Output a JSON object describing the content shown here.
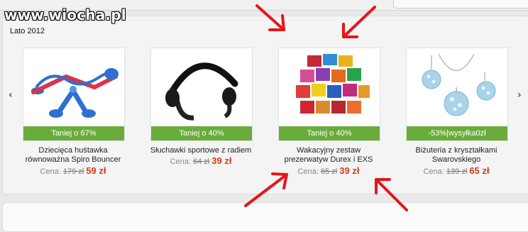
{
  "watermark": "www.wiocha.pl",
  "section_title": "Lato 2012",
  "nav": {
    "prev": "‹",
    "next": "›"
  },
  "products": [
    {
      "badge": "Taniej o 67%",
      "title_line1": "Dziecięca huśtawka",
      "title_line2": "równoważna Spiro Bouncer",
      "price_label": "Cena:",
      "old_price": "179 zł",
      "new_price": "59 zł"
    },
    {
      "badge": "Taniej o 40%",
      "title_line1": "Słuchawki sportowe z radiem",
      "title_line2": "",
      "price_label": "Cena:",
      "old_price": "64 zł",
      "new_price": "39 zł"
    },
    {
      "badge": "Taniej o 40%",
      "title_line1": "Wakacyjny zestaw",
      "title_line2": "prezerwatyw Durex i EXS",
      "price_label": "Cena:",
      "old_price": "65 zł",
      "new_price": "39 zł"
    },
    {
      "badge": "-53%|wysyłka0zł",
      "title_line1": "Biżuteria z kryształkami",
      "title_line2": "Swarovskiego",
      "price_label": "Cena:",
      "old_price": "139 zł",
      "new_price": "65 zł"
    }
  ],
  "colors": {
    "badge_green": "#6aac3c",
    "price_red": "#d83a1a",
    "annotation_red": "#e8141b"
  }
}
